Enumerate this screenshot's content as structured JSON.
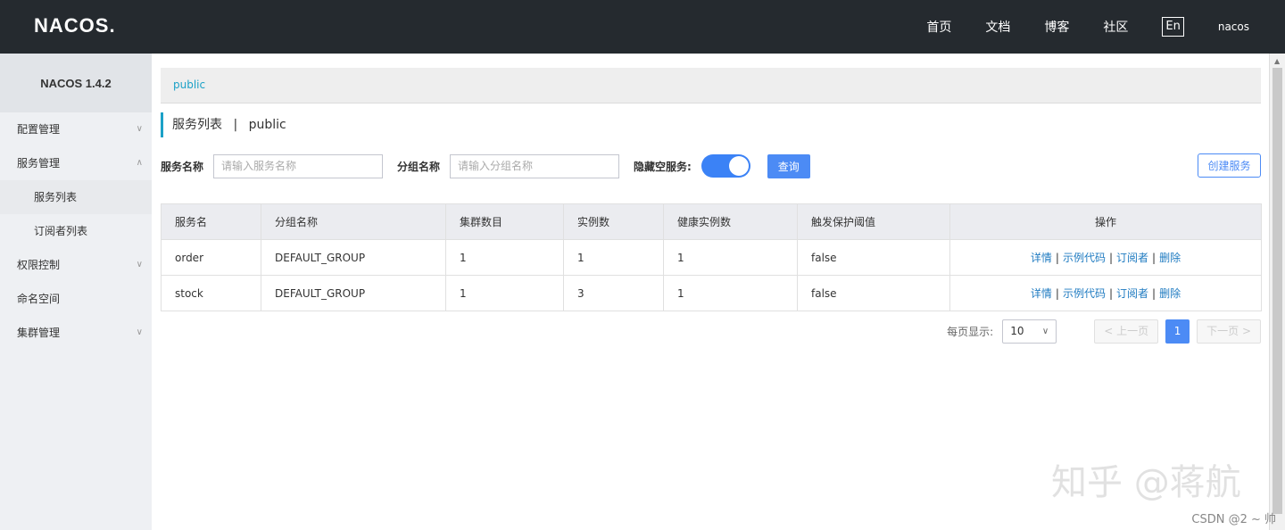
{
  "header": {
    "logo": "NACOS.",
    "nav": [
      "首页",
      "文档",
      "博客",
      "社区"
    ],
    "lang": "En",
    "user": "nacos"
  },
  "sidebar": {
    "title": "NACOS 1.4.2",
    "items": [
      {
        "label": "配置管理",
        "expanded": false
      },
      {
        "label": "服务管理",
        "expanded": true
      },
      {
        "label": "服务列表"
      },
      {
        "label": "订阅者列表"
      },
      {
        "label": "权限控制",
        "expanded": false
      },
      {
        "label": "命名空间"
      },
      {
        "label": "集群管理",
        "expanded": false
      }
    ]
  },
  "breadcrumb": {
    "namespace": "public"
  },
  "page": {
    "title": "服务列表",
    "separator": "|",
    "namespace": "public"
  },
  "filters": {
    "service_label": "服务名称",
    "service_placeholder": "请输入服务名称",
    "group_label": "分组名称",
    "group_placeholder": "请输入分组名称",
    "hide_empty_label": "隐藏空服务:",
    "hide_empty_on": true,
    "query_button": "查询",
    "create_button": "创建服务"
  },
  "table": {
    "headers": [
      "服务名",
      "分组名称",
      "集群数目",
      "实例数",
      "健康实例数",
      "触发保护阈值",
      "操作"
    ],
    "rows": [
      [
        "order",
        "DEFAULT_GROUP",
        "1",
        "1",
        "1",
        "false"
      ],
      [
        "stock",
        "DEFAULT_GROUP",
        "1",
        "3",
        "1",
        "false"
      ]
    ],
    "ops": [
      "详情",
      "示例代码",
      "订阅者",
      "删除"
    ],
    "op_sep": "|"
  },
  "pagination": {
    "per_page_label": "每页显示:",
    "per_page": "10",
    "prev": "上一页",
    "next": "下一页",
    "current": "1"
  },
  "watermark": "知乎 @蒋航",
  "credit": "CSDN @2 ~ 帅",
  "colors": {
    "accent": "#4c8bf5",
    "header_bg": "#252a2f",
    "link": "#1f7bc1",
    "breadcrumb_link": "#1ba1c7"
  }
}
